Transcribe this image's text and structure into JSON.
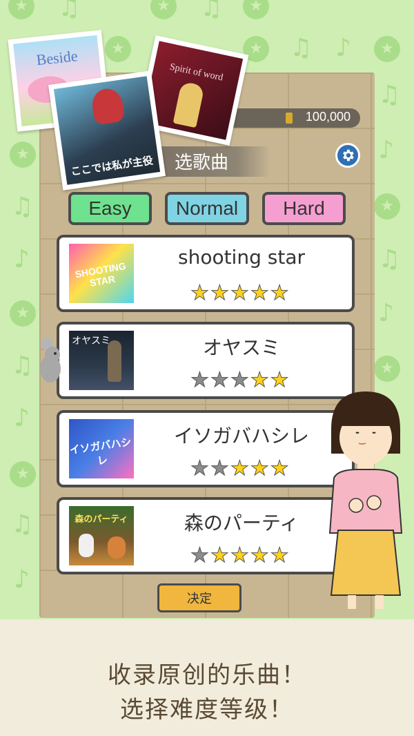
{
  "header": {
    "score": "100,000",
    "title": "选歌曲",
    "settings_icon": "gear-icon"
  },
  "albums": [
    {
      "title": "Beside"
    },
    {
      "title": "ここでは私が主役"
    },
    {
      "title": "Spirit of word"
    }
  ],
  "difficulty": {
    "easy": "Easy",
    "normal": "Normal",
    "hard": "Hard",
    "selected": "Easy"
  },
  "songs": [
    {
      "title": "shooting star",
      "thumb_text": "SHOOTING STAR",
      "rating": 5
    },
    {
      "title": "オヤスミ",
      "thumb_text": "オヤスミ",
      "rating": 2
    },
    {
      "title": "イソガバハシレ",
      "thumb_text": "イソガバハシレ",
      "rating": 3
    },
    {
      "title": "森のパーティ",
      "thumb_text": "森のパーティ",
      "rating": 4
    }
  ],
  "actions": {
    "confirm": "决定"
  },
  "promo": {
    "line1": "收录原创的乐曲！",
    "line2": "选择难度等级！"
  },
  "colors": {
    "background": "#cfeeb3",
    "easy": "#6ee28e",
    "normal": "#7fd3e3",
    "hard": "#f59fd0",
    "confirm": "#f0b63e",
    "star_on": "#ffd21a",
    "star_off": "#8d8d8d"
  }
}
